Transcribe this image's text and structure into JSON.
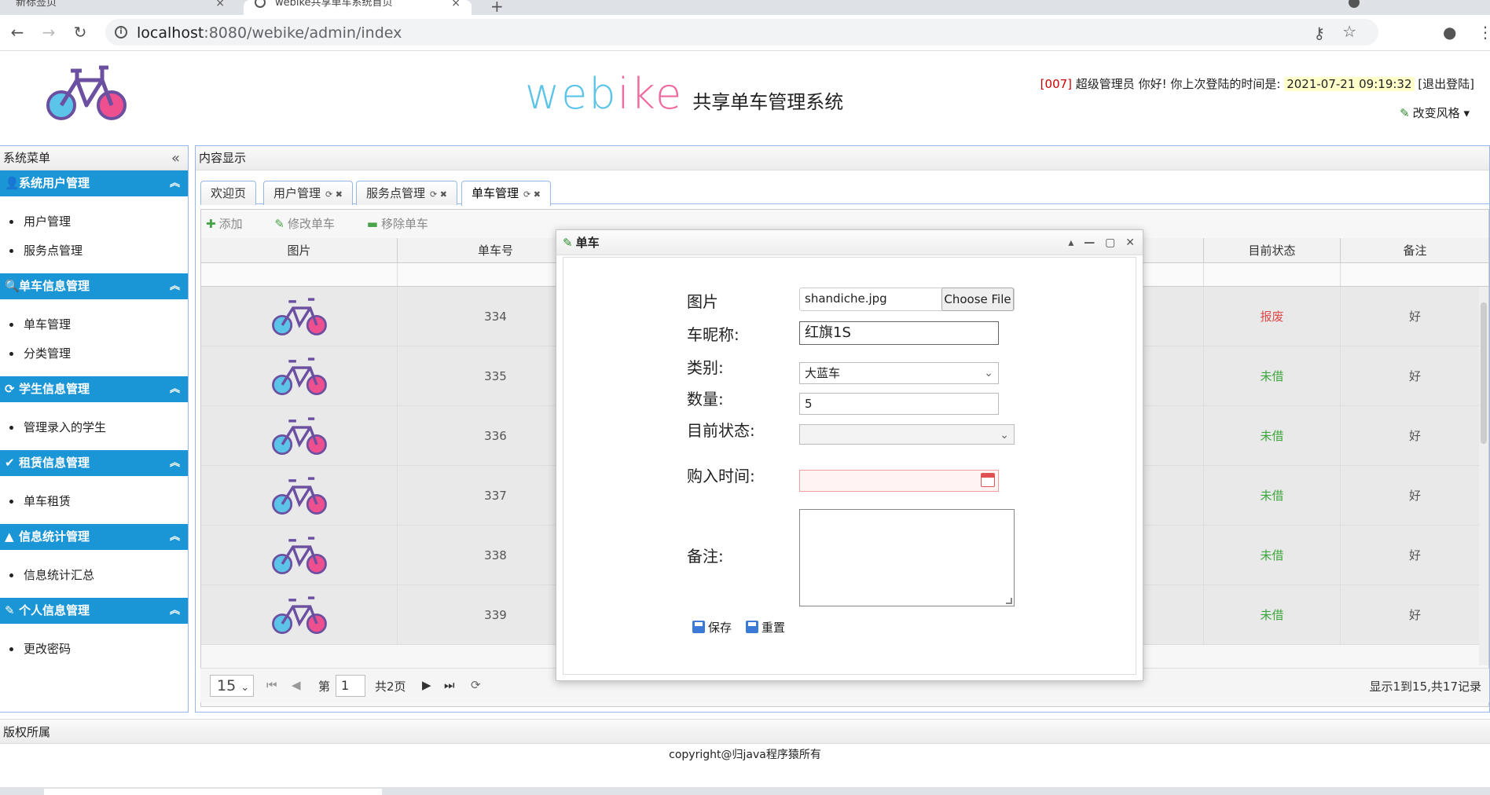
{
  "browser": {
    "tab_inactive": "新标签页",
    "tab_active": "webike共享单车系统首页",
    "url_host": "localhost",
    "url_rest": ":8080/webike/admin/index"
  },
  "header": {
    "brand_web": "web",
    "brand_ike": "ike",
    "brand_sub": "共享单车管理系统",
    "user_code": "[007]",
    "user_greeting": "超级管理员 你好! 你上次登陆的时间是:",
    "last_login": "2021-07-21 09:19:32",
    "logout": "[退出登陆]",
    "theme": "改变风格"
  },
  "sidebar": {
    "title": "系统菜单",
    "groups": [
      {
        "title": "系统用户管理",
        "items": [
          "用户管理",
          "服务点管理"
        ]
      },
      {
        "title": "单车信息管理",
        "items": [
          "单车管理",
          "分类管理"
        ]
      },
      {
        "title": "学生信息管理",
        "items": [
          "管理录入的学生"
        ]
      },
      {
        "title": "租赁信息管理",
        "items": [
          "单车租赁"
        ]
      },
      {
        "title": "信息统计管理",
        "items": [
          "信息统计汇总"
        ]
      },
      {
        "title": "个人信息管理",
        "items": [
          "更改密码"
        ]
      }
    ]
  },
  "content": {
    "title": "内容显示",
    "tabs": [
      "欢迎页",
      "用户管理",
      "服务点管理",
      "单车管理"
    ],
    "toolbar": {
      "add": "添加",
      "edit": "修改单车",
      "remove": "移除单车"
    },
    "columns": {
      "image": "图片",
      "bike_no": "单车号",
      "status": "目前状态",
      "note": "备注"
    },
    "rows": [
      {
        "no": "334",
        "status": "报废",
        "note": "好"
      },
      {
        "no": "335",
        "status": "未借",
        "note": "好"
      },
      {
        "no": "336",
        "status": "未借",
        "note": "好"
      },
      {
        "no": "337",
        "status": "未借",
        "note": "好"
      },
      {
        "no": "338",
        "status": "未借",
        "note": "好"
      },
      {
        "no": "339",
        "status": "未借",
        "note": "好"
      }
    ],
    "pager": {
      "page_size": "15",
      "page_label": "第",
      "page_num": "1",
      "total_pages": "共2页",
      "info": "显示1到15,共17记录"
    }
  },
  "dialog": {
    "title": "单车",
    "labels": {
      "image": "图片",
      "name": "车昵称:",
      "category": "类别:",
      "qty": "数量:",
      "state": "目前状态:",
      "date": "购入时间:",
      "note": "备注:"
    },
    "values": {
      "file_name": "shandiche.jpg",
      "file_button": "Choose File",
      "name": "红旗1S",
      "category": "大蓝车",
      "qty": "5",
      "state": "",
      "date": ""
    },
    "buttons": {
      "save": "保存",
      "reset": "重置"
    }
  },
  "footer": {
    "title": "版权所属",
    "text": "copyright@归java程序猿所有"
  },
  "colors": {
    "menu_blue": "#1a95d6",
    "brand_cyan": "#5bc4e8",
    "brand_pink": "#ee6aa0",
    "status_red": "#e04a4a",
    "status_green": "#3ca63c"
  }
}
